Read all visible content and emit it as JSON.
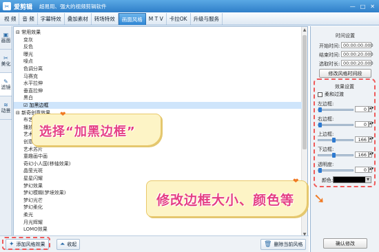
{
  "app": {
    "name": "爱剪辑",
    "slogan": "超易用、强大的视频剪辑软件",
    "window_buttons": [
      "—",
      "□",
      "✕"
    ]
  },
  "menu": {
    "tabs": [
      "视 频",
      "音 频",
      "字幕特效",
      "叠加素材",
      "转场特效",
      "画面风格",
      "M T V",
      "卡拉OK",
      "升级与服务"
    ],
    "active": "画面风格"
  },
  "sidebar": {
    "tabs": [
      {
        "icon": "▣",
        "label": "画面"
      },
      {
        "icon": "✂",
        "label": "美化"
      },
      {
        "icon": "✎",
        "label": "滤镜"
      },
      {
        "icon": "≋",
        "label": "动景"
      }
    ]
  },
  "list": {
    "rows": [
      {
        "t": "常用效果",
        "g": true
      },
      {
        "t": "变灰"
      },
      {
        "t": "反色"
      },
      {
        "t": "曝光"
      },
      {
        "t": "噪点"
      },
      {
        "t": "色调分离"
      },
      {
        "t": "马赛克"
      },
      {
        "t": "水平拉伸"
      },
      {
        "t": "垂直拉伸"
      },
      {
        "t": "黑白"
      },
      {
        "t": "加黑边框",
        "sel": true
      },
      {
        "t": "新奇创意效果",
        "g": true
      },
      {
        "t": "布艺效果"
      },
      {
        "t": "播放效果"
      },
      {
        "t": "艺术插画"
      },
      {
        "t": "创意剪影"
      },
      {
        "t": "艺术苏片"
      },
      {
        "t": "童趣画中画"
      },
      {
        "t": "奇幻小人国(移轴效果)"
      },
      {
        "t": "晶莹光斑"
      },
      {
        "t": "星星闪耀"
      },
      {
        "t": "梦幻效果"
      },
      {
        "t": "梦幻模糊(梦境效果)"
      },
      {
        "t": "梦幻光芒"
      },
      {
        "t": "梦幻柔化"
      },
      {
        "t": "柔光"
      },
      {
        "t": "月光辉耀"
      },
      {
        "t": "LOMO效果"
      }
    ]
  },
  "bottom": {
    "add_label": "添加风格效果",
    "collapse_label": "收起",
    "delete_label": "删除当前风格"
  },
  "time_settings": {
    "title": "时间设置",
    "start_label": "开始时间:",
    "start_val": "00:00:00.000",
    "end_label": "结束时间:",
    "end_val": "00:00:20.000",
    "dur_label": "选取时长:",
    "dur_val": "00:00:20.000",
    "adjust_btn": "修改风格时间段"
  },
  "effect_settings": {
    "title": "效果设置",
    "fade_label": "柔和过渡",
    "colour_label": "颜色:",
    "sliders": [
      {
        "label": "左边框:",
        "value": "0",
        "level": 0
      },
      {
        "label": "右边框:",
        "value": "0",
        "level": 0
      },
      {
        "label": "上边框:",
        "value": "166",
        "level": 0.4
      },
      {
        "label": "下边框:",
        "value": "166",
        "level": 0.4
      },
      {
        "label": "透明度:",
        "value": "0",
        "level": 0
      }
    ]
  },
  "confirm_label": "确认修改",
  "callouts": {
    "c1": "选择“加黑边框”",
    "c2": "修改边框大小、颜色等"
  }
}
